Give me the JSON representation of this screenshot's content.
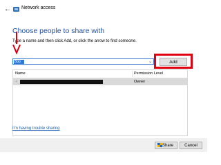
{
  "window": {
    "title": "Network access",
    "back_icon": "back-arrow-icon",
    "title_icon": "network-folder-icon"
  },
  "main": {
    "heading": "Choose people to share with",
    "instructions": "Type a name and then click Add, or click the arrow to find someone.",
    "name_input": {
      "value": "Bob"
    },
    "add_label": "Add"
  },
  "table": {
    "columns": [
      "Name",
      "Permission Level"
    ],
    "rows": [
      {
        "name": "",
        "permission": "Owner"
      }
    ]
  },
  "trouble_link": "I'm having trouble sharing",
  "footer": {
    "share_label": "Share",
    "cancel_label": "Cancel"
  },
  "colors": {
    "heading": "#1e4fa8",
    "highlight": "#e00010",
    "link": "#1a5fb4"
  }
}
